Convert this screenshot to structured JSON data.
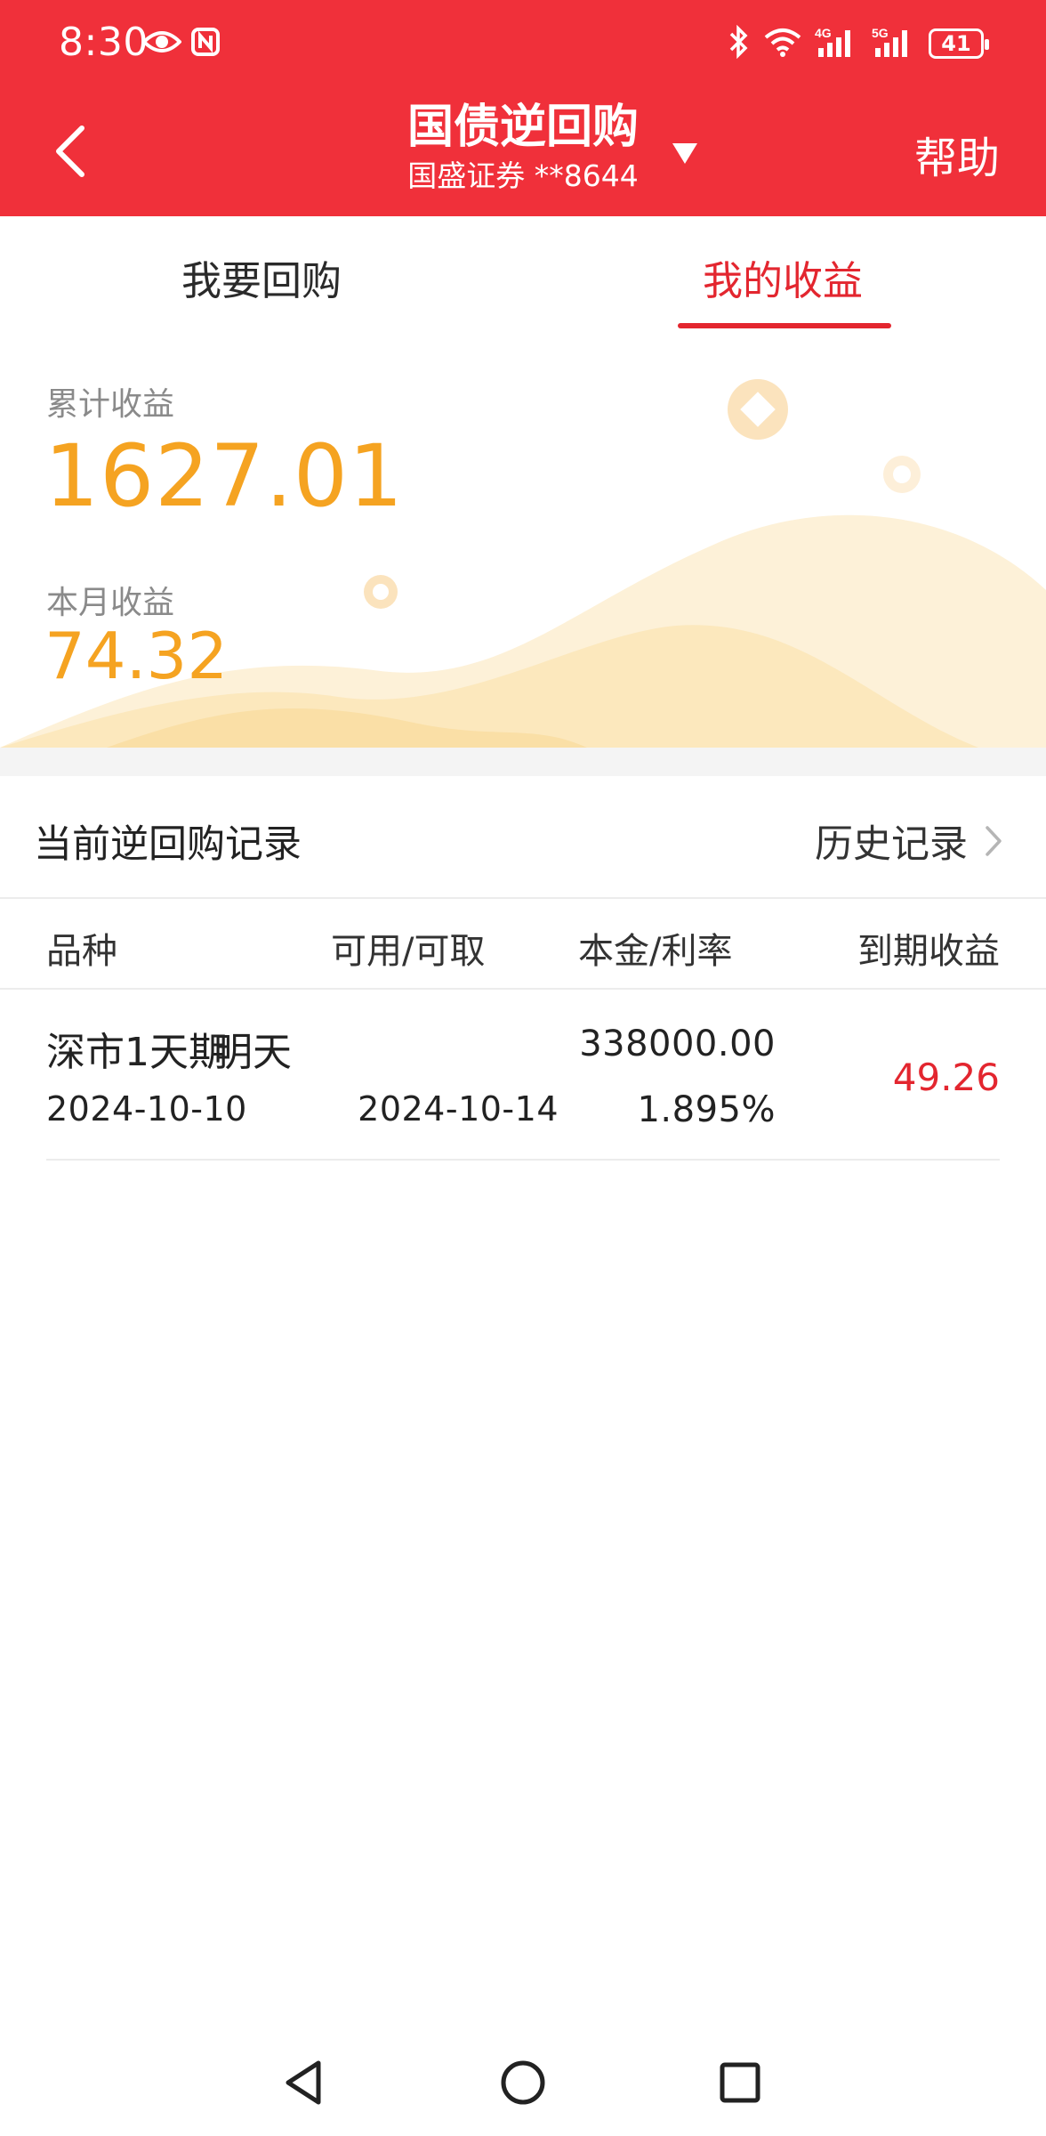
{
  "status_bar": {
    "time": "8:30",
    "battery": "41",
    "network_4g": "4G",
    "network_5g": "5G"
  },
  "header": {
    "title": "国债逆回购",
    "subtitle": "国盛证券 **8644",
    "help_label": "帮助"
  },
  "tabs": [
    {
      "label": "我要回购",
      "active": false
    },
    {
      "label": "我的收益",
      "active": true
    }
  ],
  "summary": {
    "total_label": "累计收益",
    "total_value": "1627.01",
    "month_label": "本月收益",
    "month_value": "74.32"
  },
  "records": {
    "title": "当前逆回购记录",
    "history_label": "历史记录",
    "columns": [
      "品种",
      "可用/可取",
      "本金/利率",
      "到期收益"
    ],
    "rows": [
      {
        "name": "深市1天期",
        "date": "2024-10-10",
        "available": "明天",
        "available_date": "2024-10-14",
        "principal": "338000.00",
        "rate": "1.895%",
        "income": "49.26"
      }
    ]
  },
  "colors": {
    "brand_red": "#f0303a",
    "accent_red": "#e3262f",
    "amount_orange": "#f5a321"
  }
}
